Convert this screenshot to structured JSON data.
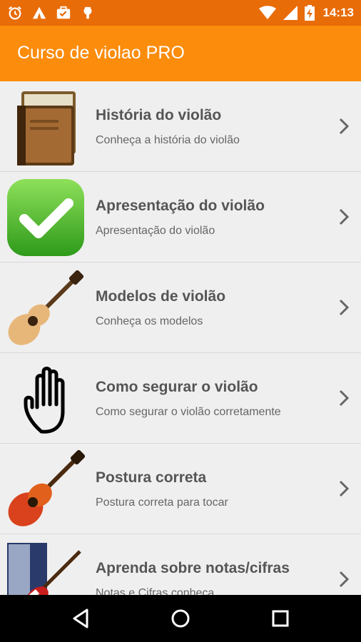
{
  "status_bar": {
    "time": "14:13",
    "left_icons": [
      "alarm-icon",
      "campfire-icon",
      "briefcase-check-icon",
      "android-icon"
    ],
    "right_icons": [
      "wifi-icon",
      "signal-icon",
      "battery-charging-icon"
    ]
  },
  "app_bar": {
    "title": "Curso de violao PRO",
    "color": "#fb8c0c"
  },
  "menu": {
    "items": [
      {
        "title": "História do violão",
        "subtitle": "Conheça a história do violão",
        "icon": "books-icon"
      },
      {
        "title": "Apresentação do violão",
        "subtitle": "Apresentação do violão",
        "icon": "checkmark-icon"
      },
      {
        "title": "Modelos de violão",
        "subtitle": "Conheça os modelos",
        "icon": "acoustic-guitar-icon"
      },
      {
        "title": "Como segurar o violão",
        "subtitle": "Como segurar o violão corretamente",
        "icon": "hand-icon"
      },
      {
        "title": "Postura correta",
        "subtitle": "Postura correta para tocar",
        "icon": "red-guitar-icon"
      },
      {
        "title": "Aprenda sobre notas/cifras",
        "subtitle": "Notas e Cifras conheça",
        "icon": "guitar-door-icon"
      }
    ]
  },
  "nav_bar": {
    "buttons": [
      "back-icon",
      "home-icon",
      "recents-icon"
    ]
  }
}
